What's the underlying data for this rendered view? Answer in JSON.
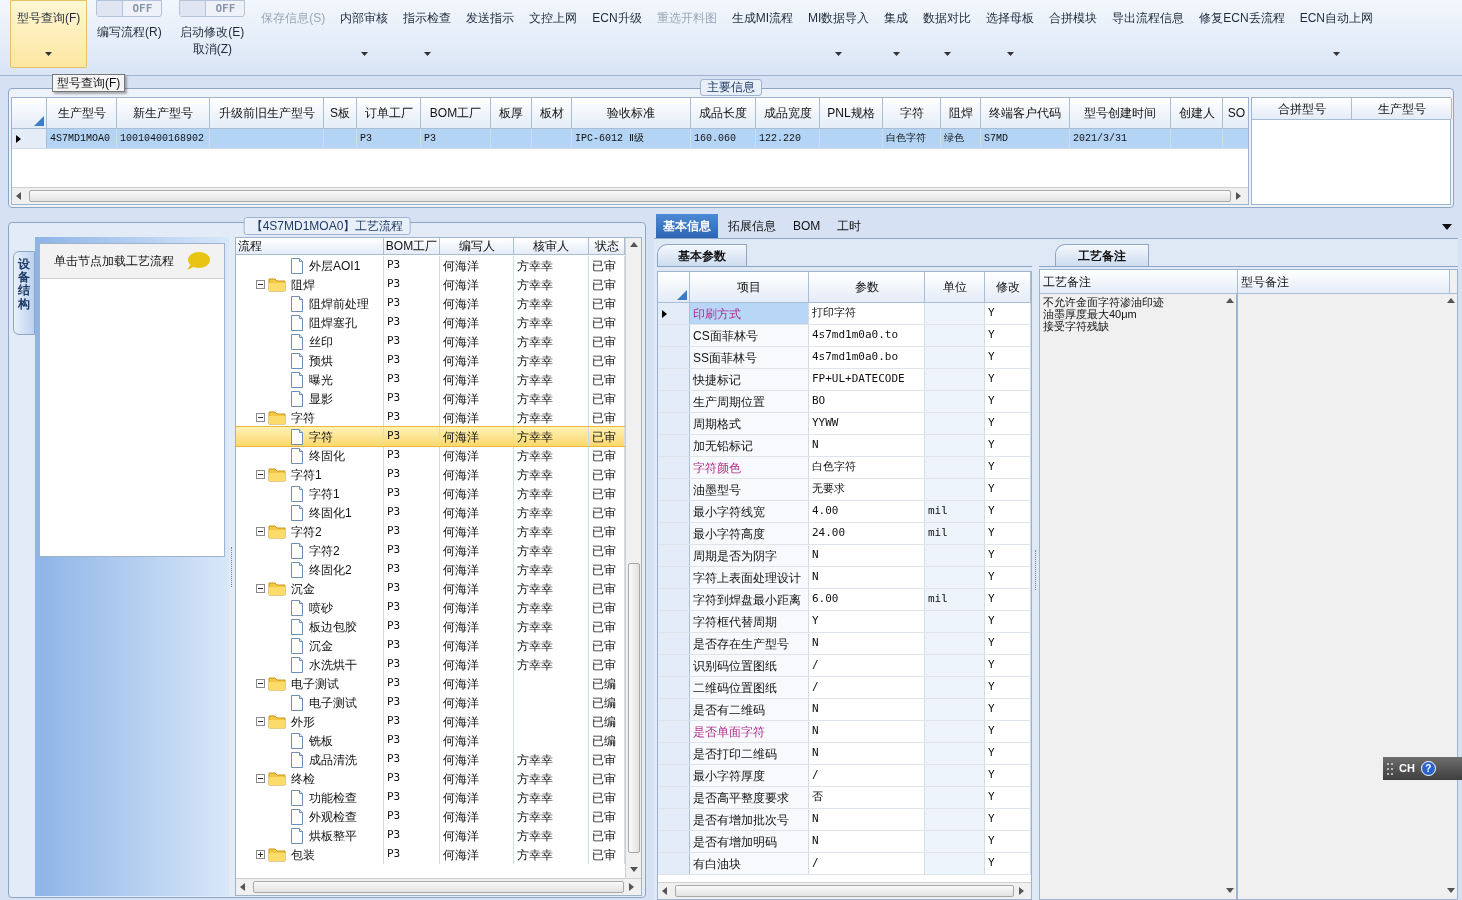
{
  "toolbar": [
    {
      "kind": "button",
      "label": "型号查询(F)",
      "selected": true,
      "disabled": false,
      "dropdown": true
    },
    {
      "kind": "toggle",
      "label": "编写流程(R)",
      "switch": "OFF",
      "on": false
    },
    {
      "kind": "toggle",
      "label": "启动修改(E)",
      "sublabel": "取消(Z)",
      "switch": "OFF",
      "on": false
    },
    {
      "kind": "button",
      "label": "保存信息(S)",
      "selected": false,
      "disabled": true,
      "dropdown": false
    },
    {
      "kind": "button",
      "label": "内部审核",
      "selected": false,
      "disabled": false,
      "dropdown": true
    },
    {
      "kind": "button",
      "label": "指示检查",
      "selected": false,
      "disabled": false,
      "dropdown": true
    },
    {
      "kind": "button",
      "label": "发送指示",
      "selected": false,
      "disabled": false,
      "dropdown": false
    },
    {
      "kind": "button",
      "label": "文控上网",
      "selected": false,
      "disabled": false,
      "dropdown": false
    },
    {
      "kind": "button",
      "label": "ECN升级",
      "selected": false,
      "disabled": false,
      "dropdown": false
    },
    {
      "kind": "button",
      "label": "重选开料图",
      "selected": false,
      "disabled": true,
      "dropdown": false
    },
    {
      "kind": "button",
      "label": "生成MI流程",
      "selected": false,
      "disabled": false,
      "dropdown": false
    },
    {
      "kind": "button",
      "label": "MI数据导入",
      "selected": false,
      "disabled": false,
      "dropdown": true
    },
    {
      "kind": "button",
      "label": "集成",
      "selected": false,
      "disabled": false,
      "dropdown": true
    },
    {
      "kind": "button",
      "label": "数据对比",
      "selected": false,
      "disabled": false,
      "dropdown": true
    },
    {
      "kind": "button",
      "label": "选择母板",
      "selected": false,
      "disabled": false,
      "dropdown": true
    },
    {
      "kind": "button",
      "label": "合拼模块",
      "selected": false,
      "disabled": false,
      "dropdown": false
    },
    {
      "kind": "button",
      "label": "导出流程信息",
      "selected": false,
      "disabled": false,
      "dropdown": false
    },
    {
      "kind": "button",
      "label": "修复ECN丢流程",
      "selected": false,
      "disabled": false,
      "dropdown": false
    },
    {
      "kind": "button",
      "label": "ECN自动上网",
      "selected": false,
      "disabled": false,
      "dropdown": true
    }
  ],
  "tooltip": "型号查询(F)",
  "main_info": {
    "title": "主要信息",
    "columns": [
      "生产型号",
      "新生产型号",
      "升级前旧生产型号",
      "S板",
      "订单工厂",
      "BOM工厂",
      "板厚",
      "板材",
      "验收标准",
      "成品长度",
      "成品宽度",
      "PNL规格",
      "字符",
      "阻焊",
      "终端客户代码",
      "型号创建时间",
      "创建人",
      "SO"
    ],
    "rows": [
      {
        "selected": true,
        "cells": [
          "4S7MD1MOA0",
          "10010400168902",
          null,
          null,
          "P3",
          "P3",
          null,
          null,
          "IPC-6012 Ⅱ级",
          "160.060",
          "122.220",
          null,
          "白色字符",
          "绿色",
          "S7MD",
          "2021/3/31",
          null,
          null
        ]
      }
    ],
    "merge_columns": [
      "合拼型号",
      "生产型号"
    ]
  },
  "process": {
    "title": "【4S7MD1MOA0】工艺流程",
    "side_tab": "设备结构",
    "hint": "单击节点加载工艺流程",
    "columns": [
      "流程",
      "BOM工厂",
      "编写人",
      "核审人",
      "状态"
    ],
    "continued": [
      {
        "name": "外层AOI1",
        "bom": "P3",
        "writer": "何海洋",
        "reviewer": "方幸幸",
        "status": "已审",
        "selected": false
      }
    ],
    "groups": [
      {
        "name": "阻焊",
        "bom": "P3",
        "writer": "何海洋",
        "reviewer": "方幸幸",
        "status": "已审",
        "selected": false,
        "expanded": true,
        "children": [
          {
            "name": "阻焊前处理",
            "bom": "P3",
            "writer": "何海洋",
            "reviewer": "方幸幸",
            "status": "已审",
            "selected": false
          },
          {
            "name": "阻焊塞孔",
            "bom": "P3",
            "writer": "何海洋",
            "reviewer": "方幸幸",
            "status": "已审",
            "selected": false
          },
          {
            "name": "丝印",
            "bom": "P3",
            "writer": "何海洋",
            "reviewer": "方幸幸",
            "status": "已审",
            "selected": false
          },
          {
            "name": "预烘",
            "bom": "P3",
            "writer": "何海洋",
            "reviewer": "方幸幸",
            "status": "已审",
            "selected": false
          },
          {
            "name": "曝光",
            "bom": "P3",
            "writer": "何海洋",
            "reviewer": "方幸幸",
            "status": "已审",
            "selected": false
          },
          {
            "name": "显影",
            "bom": "P3",
            "writer": "何海洋",
            "reviewer": "方幸幸",
            "status": "已审",
            "selected": false
          }
        ]
      },
      {
        "name": "字符",
        "bom": "P3",
        "writer": "何海洋",
        "reviewer": "方幸幸",
        "status": "已审",
        "selected": false,
        "expanded": true,
        "children": [
          {
            "name": "字符",
            "bom": "P3",
            "writer": "何海洋",
            "reviewer": "方幸幸",
            "status": "已审",
            "selected": true
          },
          {
            "name": "终固化",
            "bom": "P3",
            "writer": "何海洋",
            "reviewer": "方幸幸",
            "status": "已审",
            "selected": false
          }
        ]
      },
      {
        "name": "字符1",
        "bom": "P3",
        "writer": "何海洋",
        "reviewer": "方幸幸",
        "status": "已审",
        "selected": false,
        "expanded": true,
        "children": [
          {
            "name": "字符1",
            "bom": "P3",
            "writer": "何海洋",
            "reviewer": "方幸幸",
            "status": "已审",
            "selected": false
          },
          {
            "name": "终固化1",
            "bom": "P3",
            "writer": "何海洋",
            "reviewer": "方幸幸",
            "status": "已审",
            "selected": false
          }
        ]
      },
      {
        "name": "字符2",
        "bom": "P3",
        "writer": "何海洋",
        "reviewer": "方幸幸",
        "status": "已审",
        "selected": false,
        "expanded": true,
        "children": [
          {
            "name": "字符2",
            "bom": "P3",
            "writer": "何海洋",
            "reviewer": "方幸幸",
            "status": "已审",
            "selected": false
          },
          {
            "name": "终固化2",
            "bom": "P3",
            "writer": "何海洋",
            "reviewer": "方幸幸",
            "status": "已审",
            "selected": false
          }
        ]
      },
      {
        "name": "沉金",
        "bom": "P3",
        "writer": "何海洋",
        "reviewer": "方幸幸",
        "status": "已审",
        "selected": false,
        "expanded": true,
        "children": [
          {
            "name": "喷砂",
            "bom": "P3",
            "writer": "何海洋",
            "reviewer": "方幸幸",
            "status": "已审",
            "selected": false
          },
          {
            "name": "板边包胶",
            "bom": "P3",
            "writer": "何海洋",
            "reviewer": "方幸幸",
            "status": "已审",
            "selected": false
          },
          {
            "name": "沉金",
            "bom": "P3",
            "writer": "何海洋",
            "reviewer": "方幸幸",
            "status": "已审",
            "selected": false
          },
          {
            "name": "水洗烘干",
            "bom": "P3",
            "writer": "何海洋",
            "reviewer": "方幸幸",
            "status": "已审",
            "selected": false
          }
        ]
      },
      {
        "name": "电子测试",
        "bom": "P3",
        "writer": "何海洋",
        "status": "已编",
        "selected": false,
        "expanded": true,
        "children": [
          {
            "name": "电子测试",
            "bom": "P3",
            "writer": "何海洋",
            "status": "已编",
            "selected": false
          }
        ]
      },
      {
        "name": "外形",
        "bom": "P3",
        "writer": "何海洋",
        "status": "已编",
        "selected": false,
        "expanded": true,
        "children": [
          {
            "name": "铣板",
            "bom": "P3",
            "writer": "何海洋",
            "status": "已编",
            "selected": false
          },
          {
            "name": "成品清洗",
            "bom": "P3",
            "writer": "何海洋",
            "reviewer": "方幸幸",
            "status": "已审",
            "selected": false
          }
        ]
      },
      {
        "name": "终检",
        "bom": "P3",
        "writer": "何海洋",
        "reviewer": "方幸幸",
        "status": "已审",
        "selected": false,
        "expanded": true,
        "children": [
          {
            "name": "功能检查",
            "bom": "P3",
            "writer": "何海洋",
            "reviewer": "方幸幸",
            "status": "已审",
            "selected": false
          },
          {
            "name": "外观检查",
            "bom": "P3",
            "writer": "何海洋",
            "reviewer": "方幸幸",
            "status": "已审",
            "selected": false
          },
          {
            "name": "烘板整平",
            "bom": "P3",
            "writer": "何海洋",
            "reviewer": "方幸幸",
            "status": "已审",
            "selected": false
          }
        ]
      },
      {
        "name": "包装",
        "bom": "P3",
        "writer": "何海洋",
        "reviewer": "方幸幸",
        "status": "已审",
        "selected": false,
        "expanded": false
      }
    ]
  },
  "detail": {
    "tabs": [
      {
        "label": "基本信息",
        "selected": true
      },
      {
        "label": "拓展信息",
        "selected": false
      },
      {
        "label": "BOM",
        "selected": false
      },
      {
        "label": "工时",
        "selected": false
      }
    ],
    "params_title": "基本参数",
    "param_columns": [
      "项目",
      "参数",
      "单位",
      "修改"
    ],
    "params": [
      {
        "item": "印刷方式",
        "value": "打印字符",
        "modified": "Y",
        "selected": true,
        "flagged": true
      },
      {
        "item": "CS面菲林号",
        "value": "4s7md1m0a0.to",
        "modified": "Y",
        "selected": false,
        "flagged": false
      },
      {
        "item": "SS面菲林号",
        "value": "4s7md1m0a0.bo",
        "modified": "Y",
        "selected": false,
        "flagged": false
      },
      {
        "item": "快捷标记",
        "value": "FP+UL+DATECODE",
        "modified": "Y",
        "selected": false,
        "flagged": false
      },
      {
        "item": "生产周期位置",
        "value": "BO",
        "modified": "Y",
        "selected": false,
        "flagged": false
      },
      {
        "item": "周期格式",
        "value": "YYWW",
        "modified": "Y",
        "selected": false,
        "flagged": false
      },
      {
        "item": "加无铅标记",
        "value": "N",
        "modified": "Y",
        "selected": false,
        "flagged": false
      },
      {
        "item": "字符颜色",
        "value": "白色字符",
        "modified": "Y",
        "selected": false,
        "flagged": true
      },
      {
        "item": "油墨型号",
        "value": "无要求",
        "modified": "Y",
        "selected": false,
        "flagged": false
      },
      {
        "item": "最小字符线宽",
        "value": "4.00",
        "unit": "mil",
        "modified": "Y",
        "selected": false,
        "flagged": false
      },
      {
        "item": "最小字符高度",
        "value": "24.00",
        "unit": "mil",
        "modified": "Y",
        "selected": false,
        "flagged": false
      },
      {
        "item": "周期是否为阴字",
        "value": "N",
        "modified": "Y",
        "selected": false,
        "flagged": false
      },
      {
        "item": "字符上表面处理设计",
        "value": "N",
        "modified": "Y",
        "selected": false,
        "flagged": false
      },
      {
        "item": "字符到焊盘最小距离",
        "value": "6.00",
        "unit": "mil",
        "modified": "Y",
        "selected": false,
        "flagged": false
      },
      {
        "item": "字符框代替周期",
        "value": "Y",
        "modified": "Y",
        "selected": false,
        "flagged": false
      },
      {
        "item": "是否存在生产型号",
        "value": "N",
        "modified": "Y",
        "selected": false,
        "flagged": false
      },
      {
        "item": "识别码位置图纸",
        "value": "/",
        "modified": "Y",
        "selected": false,
        "flagged": false
      },
      {
        "item": "二维码位置图纸",
        "value": "/",
        "modified": "Y",
        "selected": false,
        "flagged": false
      },
      {
        "item": "是否有二维码",
        "value": "N",
        "modified": "Y",
        "selected": false,
        "flagged": false
      },
      {
        "item": "是否单面字符",
        "value": "N",
        "modified": "Y",
        "selected": false,
        "flagged": true
      },
      {
        "item": "是否打印二维码",
        "value": "N",
        "modified": "Y",
        "selected": false,
        "flagged": false
      },
      {
        "item": "最小字符厚度",
        "value": "/",
        "modified": "Y",
        "selected": false,
        "flagged": false
      },
      {
        "item": "是否高平整度要求",
        "value": "否",
        "modified": "Y",
        "selected": false,
        "flagged": false
      },
      {
        "item": "是否有增加批次号",
        "value": "N",
        "modified": "Y",
        "selected": false,
        "flagged": false
      },
      {
        "item": "是否有增加明码",
        "value": "N",
        "modified": "Y",
        "selected": false,
        "flagged": false
      },
      {
        "item": "有白油块",
        "value": "/",
        "modified": "Y",
        "selected": false,
        "flagged": false
      }
    ],
    "notes_title": "工艺备注",
    "note_columns": [
      "工艺备注",
      "型号备注"
    ],
    "process_notes": [
      "不允许金面字符渗油印迹",
      "油墨厚度最大40μm",
      "接受字符残缺"
    ]
  },
  "ime_bar": {
    "language": "CH",
    "help": "?"
  }
}
